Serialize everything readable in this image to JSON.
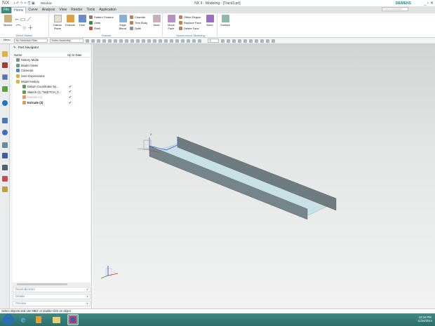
{
  "app": {
    "logo": "NX",
    "window_menu": "Window",
    "title": "NX 9 - Modeling - [Track3.prt]",
    "brand": "SIEMENS",
    "command_search_placeholder": "Find a Command"
  },
  "menu_tabs": [
    "File",
    "Home",
    "Curve",
    "Analysis",
    "View",
    "Render",
    "Tools",
    "Application"
  ],
  "ribbon": {
    "groups": [
      {
        "label": "Direct Sketch",
        "items": [
          "Sketch"
        ]
      },
      {
        "label": "Feature",
        "items": [
          "Datum Plane",
          "Extrude",
          "Hole",
          "Pattern Feature",
          "Unite",
          "Shell",
          "Edge Blend",
          "Chamfer",
          "Trim Body",
          "Draft",
          "More"
        ]
      },
      {
        "label": "Synchronous Modeling",
        "items": [
          "Move Face",
          "Offset Region",
          "Replace Face",
          "Delete Face",
          "More"
        ]
      },
      {
        "label": "",
        "items": [
          "Surface"
        ]
      }
    ]
  },
  "toolbar": {
    "menu_label": "Menu",
    "selection_filter": "No Selection Filter",
    "assembly_scope": "Entire Assembly",
    "layer": "1"
  },
  "navigator": {
    "title": "Part Navigator",
    "columns": [
      "Name",
      "Up to Date"
    ],
    "rows": [
      {
        "label": "History Mode",
        "indent": 0,
        "uptodate": false,
        "dimmed": false,
        "bold": false
      },
      {
        "label": "Model Views",
        "indent": 0,
        "uptodate": false,
        "dimmed": false,
        "bold": false
      },
      {
        "label": "Cameras",
        "indent": 0,
        "uptodate": false,
        "dimmed": false,
        "bold": false
      },
      {
        "label": "User Expressions",
        "indent": 0,
        "uptodate": false,
        "dimmed": false,
        "bold": false
      },
      {
        "label": "Model History",
        "indent": 0,
        "uptodate": false,
        "dimmed": false,
        "bold": false
      },
      {
        "label": "Datum Coordinate Sy...",
        "indent": 1,
        "uptodate": true,
        "dimmed": false,
        "bold": false
      },
      {
        "label": "Sketch (1) \"SKETCH_0...",
        "indent": 1,
        "uptodate": true,
        "dimmed": false,
        "bold": false
      },
      {
        "label": "Extrude (2)",
        "indent": 1,
        "uptodate": true,
        "dimmed": true,
        "bold": false
      },
      {
        "label": "Extrude (3)",
        "indent": 1,
        "uptodate": true,
        "dimmed": false,
        "bold": true
      }
    ],
    "panels": [
      "Dependencies",
      "Details",
      "Preview"
    ]
  },
  "status": {
    "text": "Select objects and use MB3, or double-click an object"
  },
  "taskbar": {
    "time": "12:34 PM",
    "date": "11/24/2014"
  },
  "colors": {
    "file_tab": "#3b8a7a",
    "accent": "#2b6b9b",
    "taskbar": "#2f7572",
    "model_wall": "#6e7c7f",
    "model_floor": "#c8e0e6",
    "check": "#3a9a2a"
  }
}
